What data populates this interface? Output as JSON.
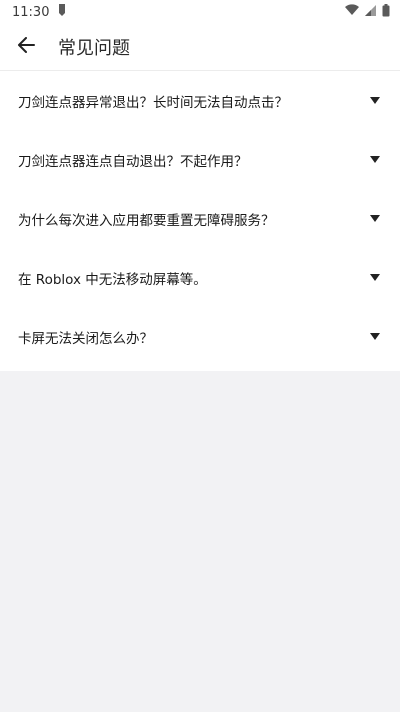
{
  "status": {
    "time": "11:30"
  },
  "header": {
    "title": "常见问题"
  },
  "faq": [
    {
      "question": "刀剑连点器异常退出？长时间无法自动点击？"
    },
    {
      "question": "刀剑连点器连点自动退出？不起作用？"
    },
    {
      "question": "为什么每次进入应用都要重置无障碍服务？"
    },
    {
      "question": "在 Roblox 中无法移动屏幕等。"
    },
    {
      "question": "卡屏无法关闭怎么办？"
    }
  ],
  "colors": {
    "surface": "#ffffff",
    "background": "#f2f2f4",
    "text": "#1a1a1a"
  },
  "icons": {
    "back": "arrow-left-icon",
    "expand": "triangle-down-icon"
  }
}
